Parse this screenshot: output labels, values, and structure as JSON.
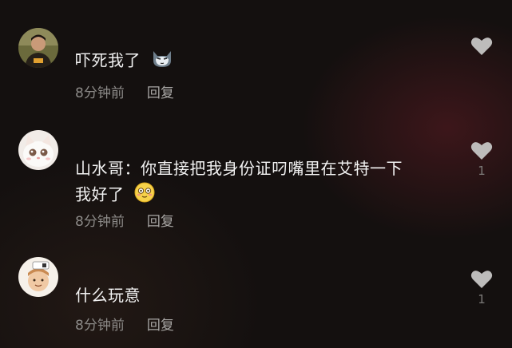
{
  "comments": [
    {
      "text": "吓死我了",
      "time": "8分钟前",
      "reply_label": "回复",
      "like_count": ""
    },
    {
      "author_prefix": "山水哥：",
      "text_line1": "你直接把我身份证叼嘴里在艾特一下",
      "text_line2": "我好了",
      "time": "8分钟前",
      "reply_label": "回复",
      "like_count": "1"
    },
    {
      "text": "什么玩意",
      "time": "8分钟前",
      "reply_label": "回复",
      "like_count": "1"
    }
  ],
  "colors": {
    "background": "#14100f",
    "text": "#f2f2f2",
    "meta": "#8c8a88",
    "heart": "#bdbcbb"
  }
}
